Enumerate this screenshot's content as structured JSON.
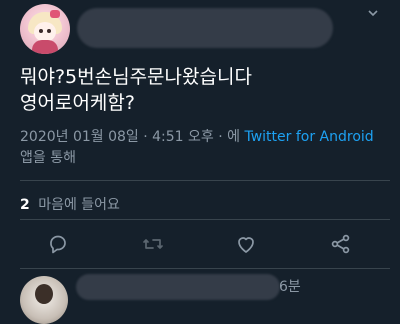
{
  "tweet": {
    "text": "뭐야?5번손님주문나왔습니다\n영어로어케함?",
    "timestamp": "2020년 01월 08일 · 4:51 오후 · 에",
    "source_app": "Twitter for Android",
    "source_suffix": "앱을 통해"
  },
  "engagement": {
    "like_count": "2",
    "like_label": "마음에 들어요"
  },
  "actions": [
    {
      "name": "reply-icon"
    },
    {
      "name": "retweet-icon"
    },
    {
      "name": "like-icon"
    },
    {
      "name": "share-icon"
    }
  ],
  "reply": {
    "time": "6분"
  },
  "colors": {
    "background": "#15202b",
    "secondary_text": "#8b98a5",
    "link": "#1da1f2",
    "divider": "#38444d"
  }
}
